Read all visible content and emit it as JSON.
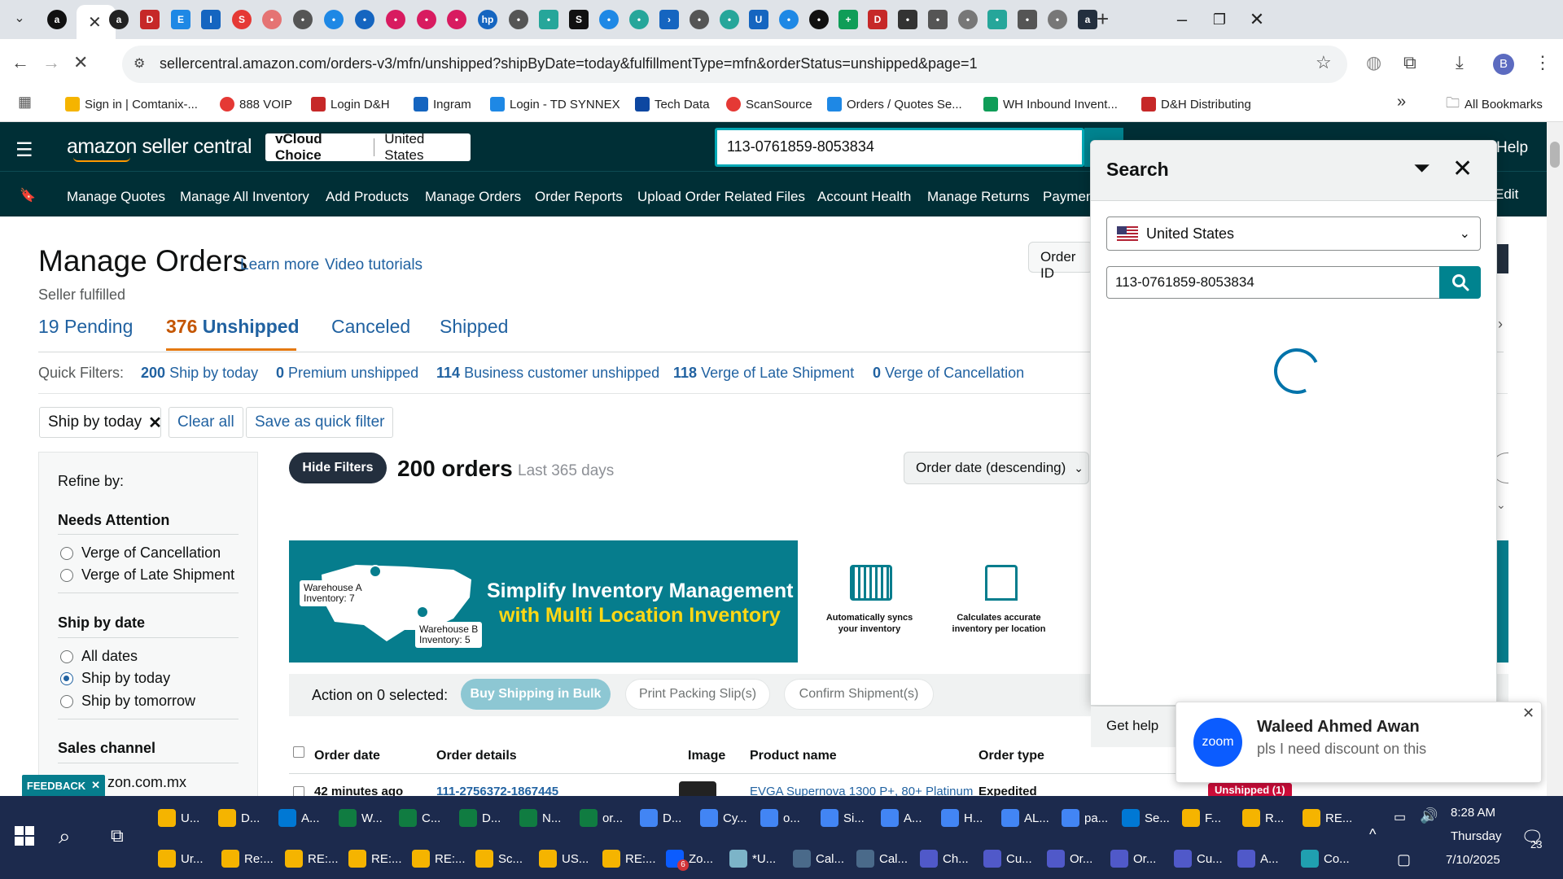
{
  "browser": {
    "url": "sellercentral.amazon.com/orders-v3/mfn/unshipped?shipByDate=today&fulfillmentType=mfn&orderStatus=unshipped&page=1",
    "profile_initial": "B",
    "bookmarks": [
      {
        "label": "Sign in | Comtanix-...",
        "color": "#f5b400"
      },
      {
        "label": "888 VOIP",
        "color": "#e53935"
      },
      {
        "label": "Login D&H",
        "color": "#c62828"
      },
      {
        "label": "Ingram",
        "color": "#1565c0"
      },
      {
        "label": "Login - TD SYNNEX",
        "color": "#1e88e5"
      },
      {
        "label": "Tech Data",
        "color": "#0d47a1"
      },
      {
        "label": "ScanSource",
        "color": "#e53935"
      },
      {
        "label": "Orders / Quotes Se...",
        "color": "#1e88e5"
      },
      {
        "label": "WH Inbound Invent...",
        "color": "#0f9d58"
      },
      {
        "label": "D&H Distributing",
        "color": "#c62828"
      }
    ],
    "all_bookmarks": "All Bookmarks"
  },
  "header": {
    "logo": "amazon seller central",
    "store_name": "vCloud Choice",
    "store_region": "United States",
    "search_value": "113-0761859-8053834",
    "help": "Help",
    "edit": "Edit",
    "nav": [
      "Manage Quotes",
      "Manage All Inventory",
      "Add Products",
      "Manage Orders",
      "Order Reports",
      "Upload Order Related Files",
      "Account Health",
      "Manage Returns",
      "Paymen"
    ]
  },
  "page": {
    "title": "Manage Orders",
    "learn_more": "Learn more",
    "video_tutorials": "Video tutorials",
    "subtitle": "Seller fulfilled",
    "order_id_label": "Order ID",
    "tabs": [
      {
        "count": "19",
        "label": "Pending"
      },
      {
        "count": "376",
        "label": "Unshipped"
      },
      {
        "count": "",
        "label": "Canceled"
      },
      {
        "count": "",
        "label": "Shipped"
      }
    ],
    "quick_filters_label": "Quick Filters:",
    "quick_filters": [
      {
        "count": "200",
        "label": "Ship by today"
      },
      {
        "count": "0",
        "label": "Premium unshipped"
      },
      {
        "count": "114",
        "label": "Business customer unshipped"
      },
      {
        "count": "118",
        "label": "Verge of Late Shipment"
      },
      {
        "count": "0",
        "label": "Verge of Cancellation"
      }
    ],
    "active_filter": "Ship by today",
    "clear_all": "Clear all",
    "save_quick_filter": "Save as quick filter",
    "refine": {
      "title": "Refine by:",
      "needs_attention": "Needs Attention",
      "attention_options": [
        "Verge of Cancellation",
        "Verge of Late Shipment"
      ],
      "ship_by_date": "Ship by date",
      "date_options": [
        "All dates",
        "Ship by today",
        "Ship by tomorrow"
      ],
      "selected_date": "Ship by today",
      "sales_channel": "Sales channel",
      "channel_option": "zon.com.mx"
    },
    "hide_filters": "Hide Filters",
    "orders_count": "200 orders",
    "last_days": "Last 365 days",
    "sort": "Order date (descending)",
    "banner": {
      "line1": "Simplify Inventory Management",
      "line2": "with Multi Location Inventory",
      "warehouse_a": "Warehouse A",
      "inventory_a": "Inventory: 7",
      "warehouse_b": "Warehouse B",
      "inventory_b": "Inventory: 5",
      "feature1_line1": "Automatically syncs",
      "feature1_line2": "your inventory",
      "feature2_line1": "Calculates accurate",
      "feature2_line2": "inventory per location"
    },
    "action_label": "Action on 0 selected:",
    "actions": [
      "Buy Shipping in Bulk",
      "Print Packing Slip(s)",
      "Confirm Shipment(s)"
    ],
    "columns": [
      "Order date",
      "Order details",
      "Image",
      "Product name",
      "Order type"
    ],
    "first_row": {
      "date": "42 minutes ago",
      "order_id": "111-2756372-1867445",
      "product": "EVGA Supernova 1300 P+, 80+ Platinum",
      "type": "Expedited",
      "status": "Unshipped (1)"
    },
    "feedback": "FEEDBACK"
  },
  "search_panel": {
    "title": "Search",
    "country": "United States",
    "query": "113-0761859-8053834",
    "get_help": "Get help"
  },
  "toast": {
    "app": "zoom",
    "sender": "Waleed Ahmed Awan",
    "message": "pls I need discount on this"
  },
  "taskbar": {
    "row1": [
      "U...",
      "D...",
      "A...",
      "W...",
      "C...",
      "D...",
      "N...",
      "or...",
      "D...",
      "Cy...",
      "o...",
      "Si...",
      "A...",
      "H...",
      "AL...",
      "pa...",
      "Se...",
      "F...",
      "R...",
      "RE..."
    ],
    "row2": [
      "Ur...",
      "Re:...",
      "RE:...",
      "RE:...",
      "RE:...",
      "Sc...",
      "US...",
      "RE:...",
      "Zo...",
      "*U...",
      "Cal...",
      "Cal...",
      "Ch...",
      "Cu...",
      "Or...",
      "Or...",
      "Cu...",
      "A...",
      "Co..."
    ],
    "time": "8:28 AM",
    "day": "Thursday",
    "date": "7/10/2025",
    "notifications": "23",
    "zoom_badge": "6"
  }
}
